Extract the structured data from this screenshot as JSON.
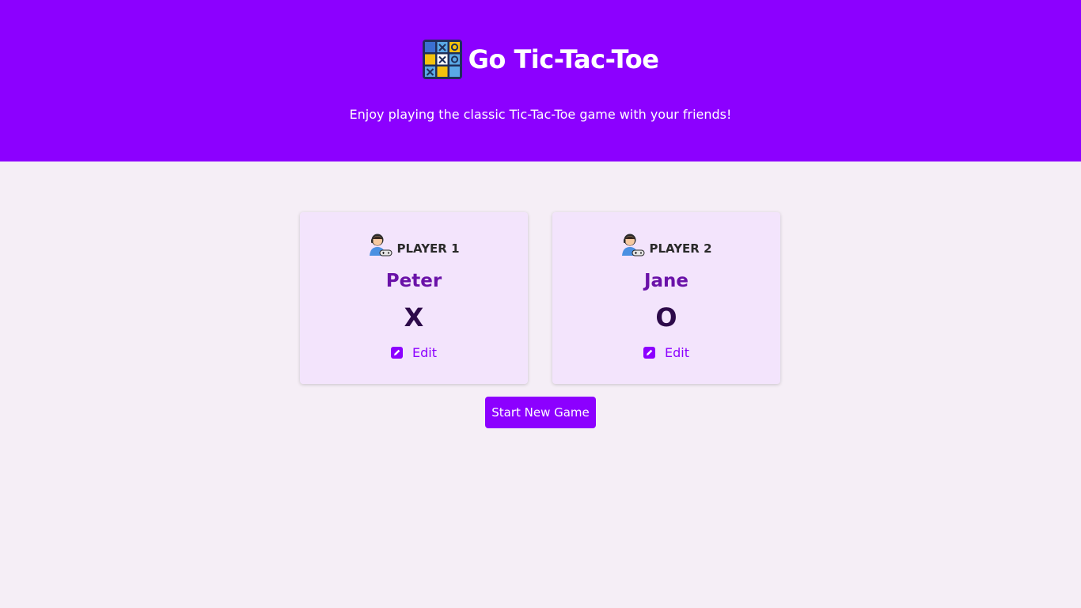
{
  "header": {
    "title": "Go Tic-Tac-Toe",
    "subtitle": "Enjoy playing the classic Tic-Tac-Toe game with your friends!",
    "logo_icon": "tic-tac-toe-grid-icon"
  },
  "players": [
    {
      "label": "PLAYER 1",
      "name": "Peter",
      "symbol": "X",
      "edit_label": "Edit",
      "avatar_icon": "gamer-avatar-icon"
    },
    {
      "label": "PLAYER 2",
      "name": "Jane",
      "symbol": "O",
      "edit_label": "Edit",
      "avatar_icon": "gamer-avatar-icon"
    }
  ],
  "actions": {
    "start_label": "Start New Game"
  },
  "colors": {
    "brand": "#8c00ff",
    "background": "#f5eef6",
    "card": "#f3e4fc",
    "name": "#6a12a8",
    "symbol": "#2d0a4a"
  }
}
